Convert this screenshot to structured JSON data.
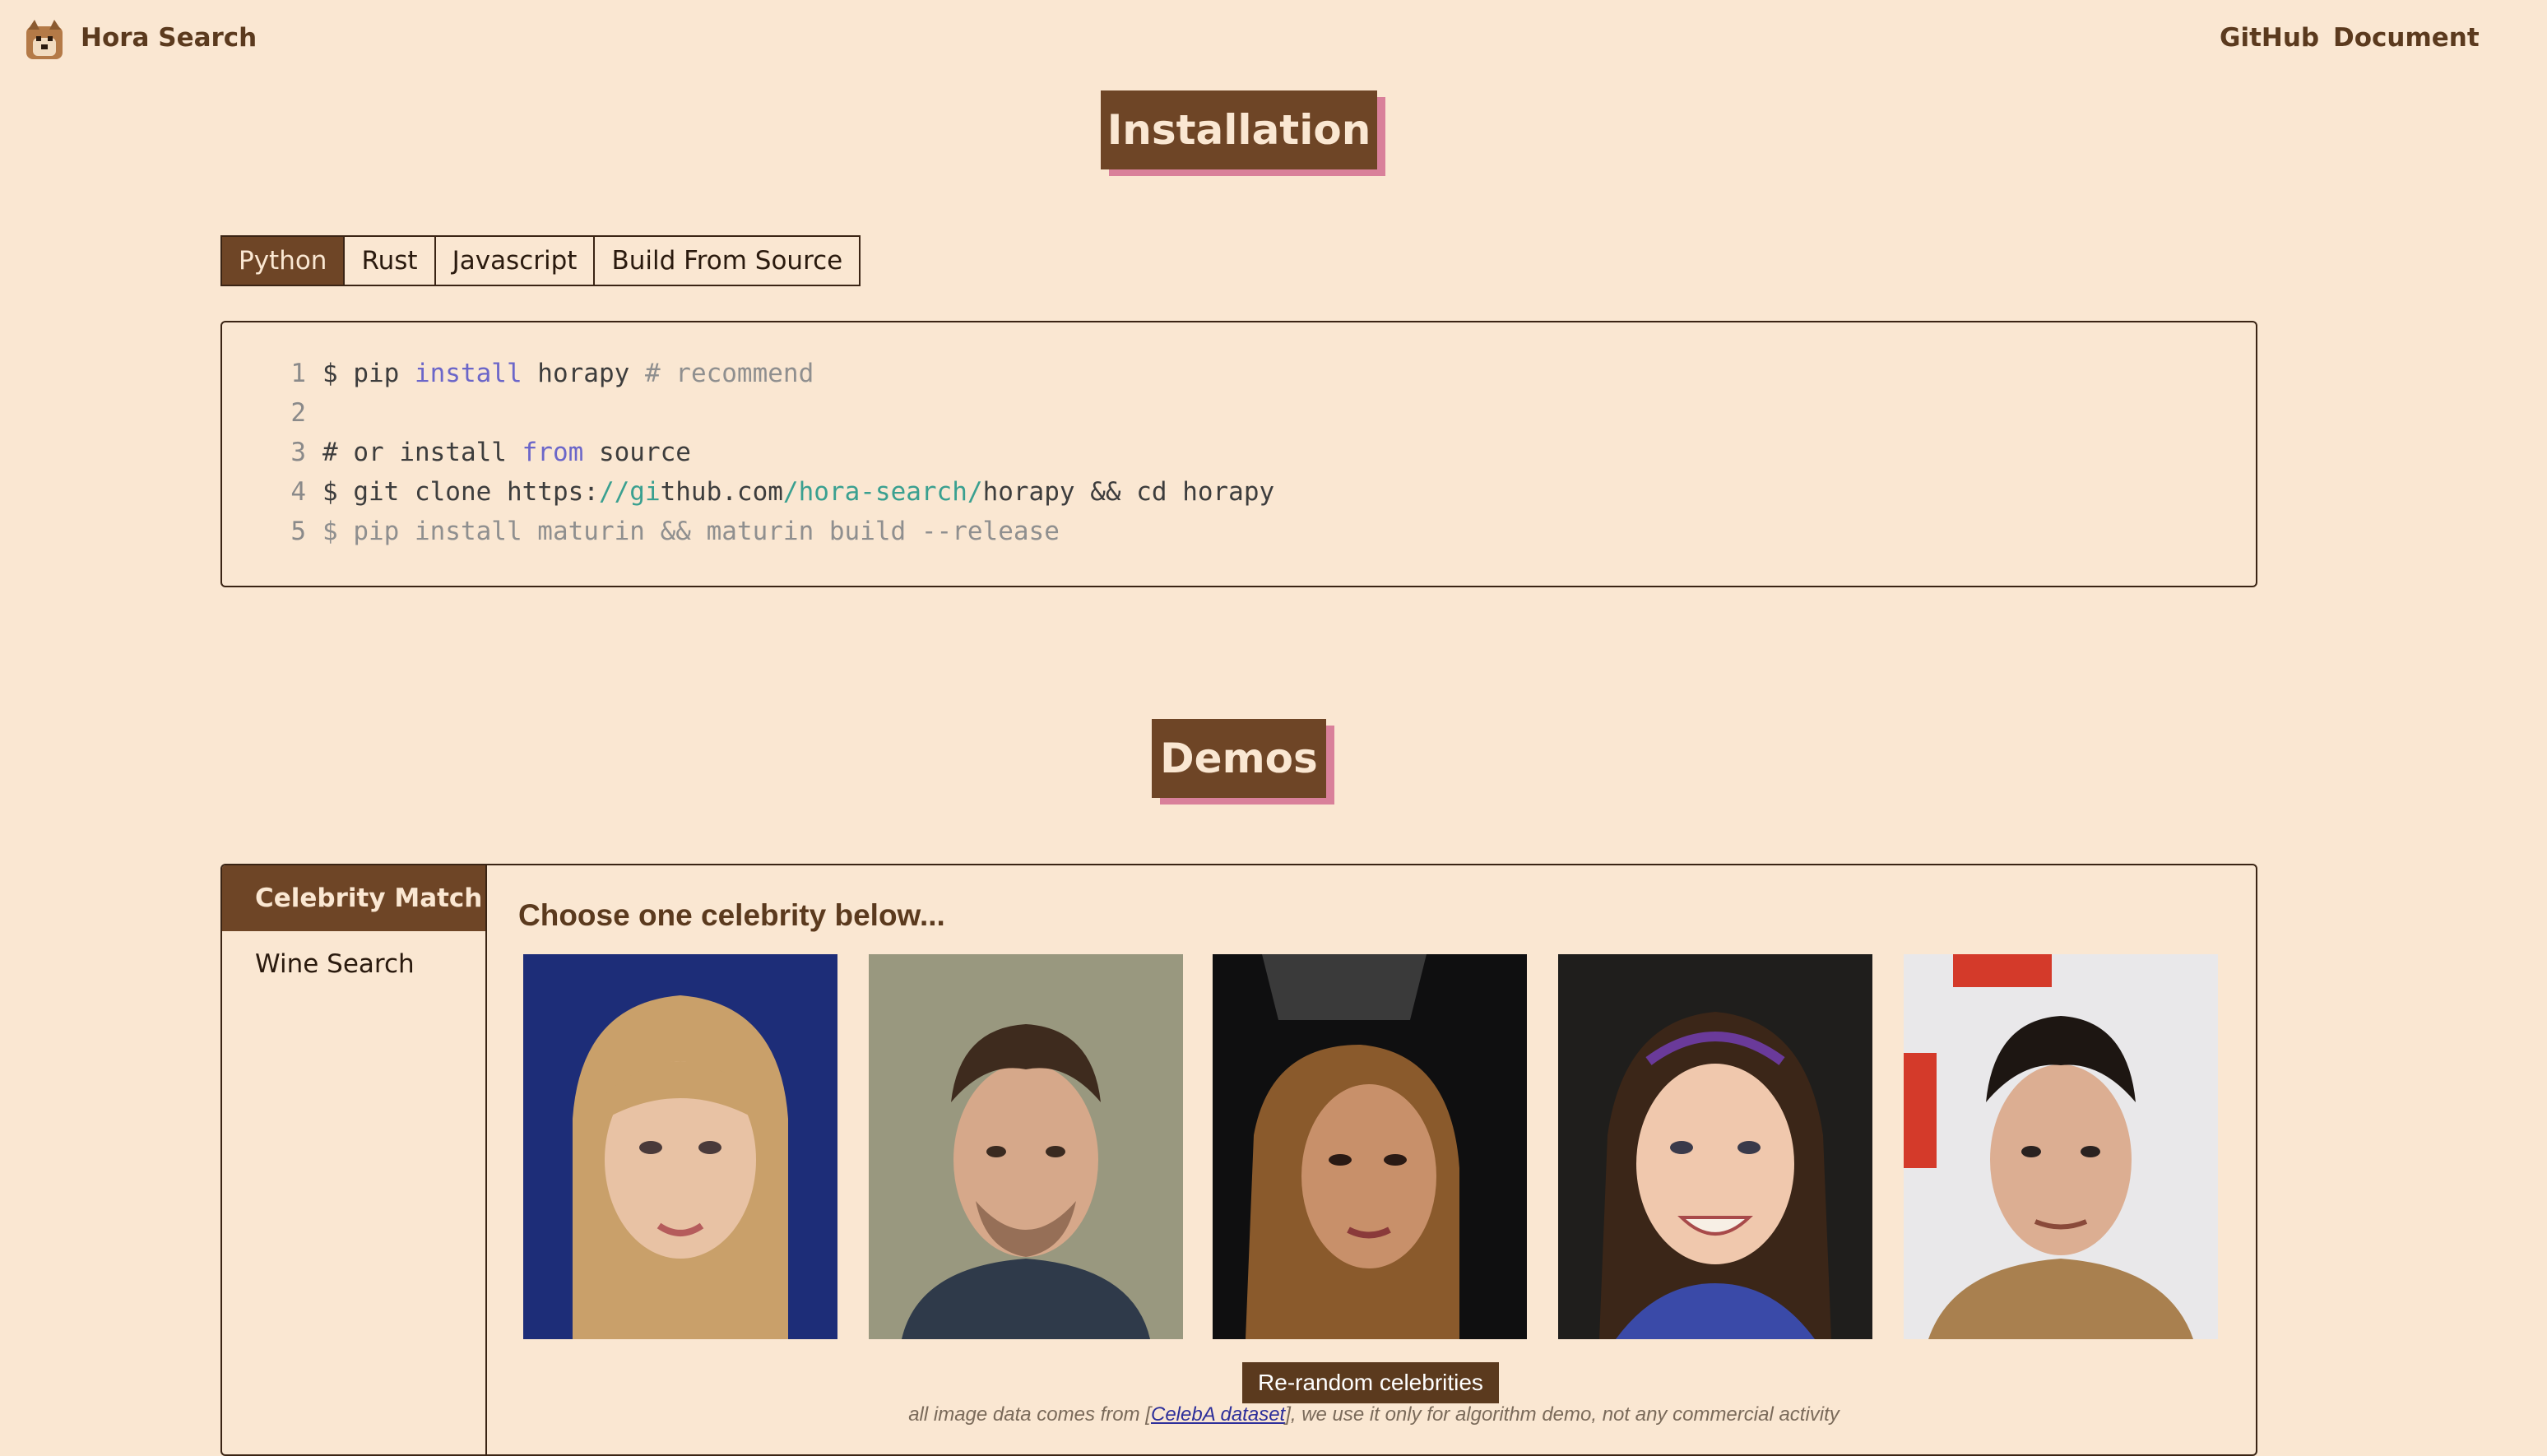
{
  "navbar": {
    "brand": "Hora Search",
    "logo_icon": "shiba-dog-logo-icon",
    "links": [
      "GitHub",
      "Document"
    ]
  },
  "installation": {
    "title": "Installation",
    "tabs": [
      "Python",
      "Rust",
      "Javascript",
      "Build From Source"
    ],
    "active_tab": "Python",
    "code_lines": [
      {
        "num": "1",
        "parts": [
          {
            "t": "$ pip ",
            "c": ""
          },
          {
            "t": "install",
            "c": "kw"
          },
          {
            "t": " horapy ",
            "c": ""
          },
          {
            "t": "# recommend",
            "c": "cm"
          }
        ]
      },
      {
        "num": "2",
        "parts": []
      },
      {
        "num": "3",
        "parts": [
          {
            "t": "# or install ",
            "c": ""
          },
          {
            "t": "from",
            "c": "kw"
          },
          {
            "t": " source",
            "c": ""
          }
        ]
      },
      {
        "num": "4",
        "parts": [
          {
            "t": "$ git clone https:",
            "c": ""
          },
          {
            "t": "//gi",
            "c": "url"
          },
          {
            "t": "thub.com",
            "c": ""
          },
          {
            "t": "/hora-search/",
            "c": "url"
          },
          {
            "t": "horapy && cd horapy",
            "c": ""
          }
        ]
      },
      {
        "num": "5",
        "parts": [
          {
            "t": "$ pip install maturin && maturin build --release",
            "c": "dim"
          }
        ]
      }
    ]
  },
  "demos": {
    "title": "Demos",
    "tabs": [
      "Celebrity Match",
      "Wine Search"
    ],
    "active_tab": "Celebrity Match",
    "prompt": "Choose one celebrity below...",
    "celebrities": [
      {
        "name": "celebrity-photo-1"
      },
      {
        "name": "celebrity-photo-2"
      },
      {
        "name": "celebrity-photo-3"
      },
      {
        "name": "celebrity-photo-4"
      },
      {
        "name": "celebrity-photo-5"
      }
    ],
    "rerandom_label": "Re-random celebrities",
    "footnote_pre": "all image data comes from [",
    "footnote_link": "CelebA dataset",
    "footnote_post": "], we use it only for algorithm demo, not any commercial activity"
  },
  "colors": {
    "background": "#fae7d2",
    "accent_brown": "#6e4526",
    "shadow_pink": "#d9809a"
  }
}
